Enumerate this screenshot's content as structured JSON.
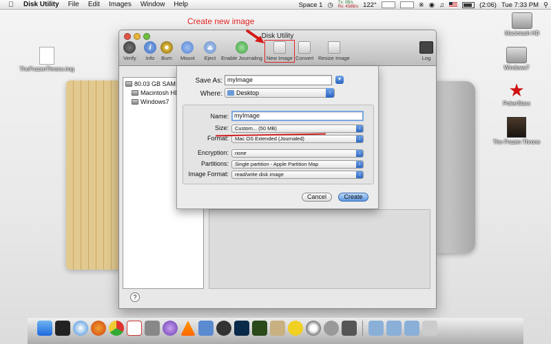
{
  "menubar": {
    "apple_icon": "apple-logo",
    "app_name": "Disk Utility",
    "menus": [
      "File",
      "Edit",
      "Images",
      "Window",
      "Help"
    ],
    "space": "Space 1",
    "net_tx": "Tx:",
    "net_rx": "Rx:",
    "net_tx_val": "0B/s",
    "net_rx_val": "458B/s",
    "temperature": "122°",
    "battery": "(2:06)",
    "clock": "Tue 7:33 PM"
  },
  "annotation": {
    "text": "Create new image",
    "color": "#e02020"
  },
  "desktop_icons": [
    {
      "label": "TheFrozenThrone.img",
      "icon": "disk-image-icon"
    },
    {
      "label": "Macintosh HD",
      "icon": "hard-drive-icon"
    },
    {
      "label": "Windows7",
      "icon": "hard-drive-icon"
    },
    {
      "label": "PokerStars",
      "icon": "pokerstars-icon"
    },
    {
      "label": "The Frozen Throne",
      "icon": "game-icon"
    }
  ],
  "window": {
    "title": "Disk Utility",
    "toolbar": [
      {
        "label": "Verify",
        "icon": "microscope-icon"
      },
      {
        "label": "Info",
        "icon": "info-icon"
      },
      {
        "label": "Burn",
        "icon": "burn-icon"
      },
      {
        "label": "Mount",
        "icon": "mount-icon"
      },
      {
        "label": "Eject",
        "icon": "eject-icon"
      },
      {
        "label": "Enable Journaling",
        "icon": "journal-icon"
      },
      {
        "label": "New Image",
        "icon": "new-image-icon"
      },
      {
        "label": "Convert",
        "icon": "convert-icon"
      },
      {
        "label": "Resize Image",
        "icon": "resize-image-icon"
      },
      {
        "label": "Log",
        "icon": "log-icon"
      }
    ],
    "sidebar": [
      {
        "label": "80.03 GB SAMSUN"
      },
      {
        "label": "Macintosh HD"
      },
      {
        "label": "Windows7"
      }
    ],
    "help": "?"
  },
  "sheet": {
    "save_as_label": "Save As:",
    "save_as_value": "myImage",
    "where_label": "Where:",
    "where_value": "Desktop",
    "name_label": "Name:",
    "name_value": "myImage",
    "size_label": "Size:",
    "size_value": "Custom... (50 MB)",
    "format_label": "Format:",
    "format_value": "Mac OS Extended (Journaled)",
    "encryption_label": "Encryption:",
    "encryption_value": "none",
    "partitions_label": "Partitions:",
    "partitions_value": "Single partition - Apple Partition Map",
    "image_format_label": "Image Format:",
    "image_format_value": "read/write disk image",
    "cancel": "Cancel",
    "create": "Create"
  },
  "dock": {
    "apps": [
      "finder",
      "terminal",
      "safari",
      "firefox",
      "chrome",
      "ical",
      "automator",
      "itunes",
      "vlc",
      "xcode",
      "dashboard",
      "photoshop",
      "dreamweaver",
      "preview",
      "adium",
      "qq",
      "system-preferences",
      "timemachine",
      "activity-monitor",
      "applications-stack",
      "documents-stack",
      "downloads-stack",
      "trash"
    ]
  },
  "colors": {
    "accent": "#3a78d8",
    "annotation_red": "#e02020"
  }
}
